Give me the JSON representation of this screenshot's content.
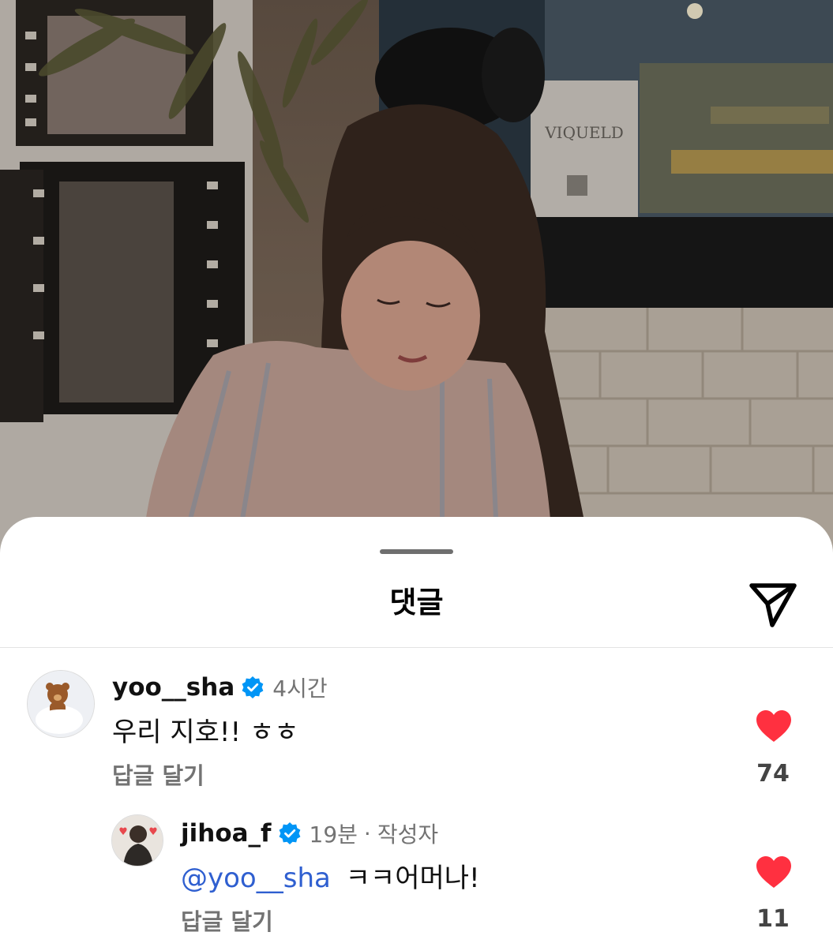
{
  "sheet": {
    "title": "댓글"
  },
  "comments": [
    {
      "username": "yoo__sha",
      "verified": true,
      "time": "4시간",
      "text": "우리 지호!! ㅎㅎ",
      "reply_label": "답글 달기",
      "liked": true,
      "like_count": "74"
    },
    {
      "username": "jihoa_f",
      "verified": true,
      "time": "19분",
      "separator": "·",
      "author_badge": "작성자",
      "mention": "@yoo__sha",
      "text": "ㅋㅋ어머나!",
      "reply_label": "답글 달기",
      "liked": true,
      "like_count": "11"
    }
  ],
  "photo": {
    "sign_text": "VIQUELD"
  },
  "colors": {
    "like_red": "#ff3040",
    "verified_blue": "#0095f6",
    "mention_blue": "#2f5fd0",
    "secondary_text": "#737373"
  },
  "icons": {
    "share": "paper-plane-icon",
    "verified": "verified-badge-icon",
    "like": "heart-icon"
  }
}
